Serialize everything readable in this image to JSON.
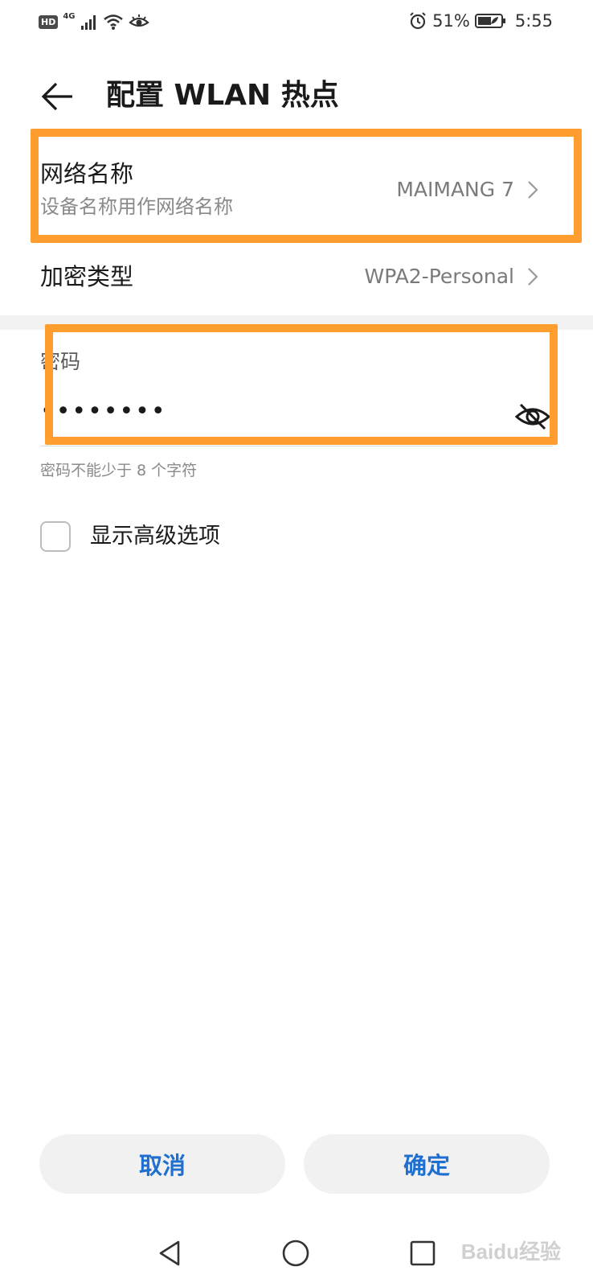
{
  "status_bar": {
    "hd_badge": "HD",
    "network_type": "4G",
    "battery_percent": "51%",
    "time": "5:55",
    "icons": [
      "hd-icon",
      "signal-icon",
      "wifi-icon",
      "eye-comfort-icon",
      "alarm-icon",
      "battery-icon"
    ]
  },
  "header": {
    "title": "配置 WLAN 热点",
    "back_icon": "back-arrow-icon"
  },
  "network_name": {
    "title": "网络名称",
    "subtitle": "设备名称用作网络名称",
    "value": "MAIMANG 7"
  },
  "encryption": {
    "title": "加密类型",
    "value": "WPA2-Personal"
  },
  "password": {
    "label": "密码",
    "value": "••••••••",
    "hint": "密码不能少于 8 个字符",
    "toggle_icon": "eye-hidden-icon"
  },
  "advanced": {
    "label": "显示高级选项",
    "checked": false
  },
  "buttons": {
    "cancel": "取消",
    "confirm": "确定"
  },
  "nav_bar": {
    "icons": [
      "nav-back-icon",
      "nav-home-icon",
      "nav-recent-icon"
    ]
  },
  "watermark": "Baidu经验",
  "colors": {
    "accent": "#1e6fd0",
    "highlight": "#ff9e2e"
  }
}
